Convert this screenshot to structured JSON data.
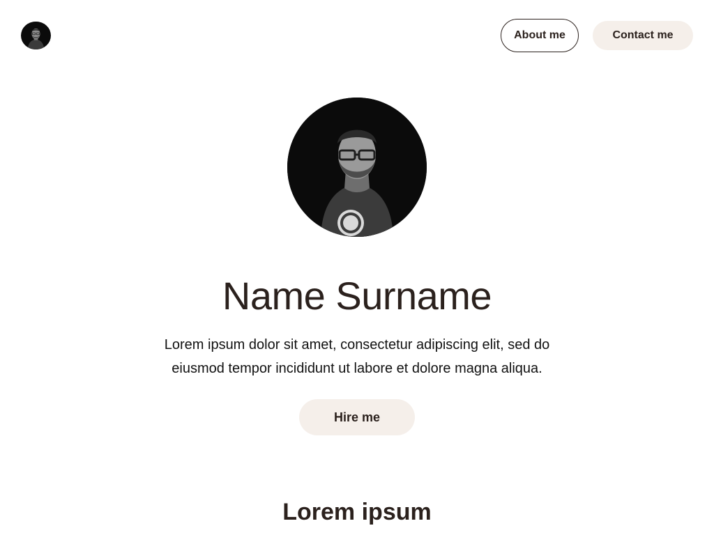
{
  "header": {
    "avatar_icon": "person-avatar-icon",
    "nav": {
      "about_label": "About me",
      "contact_label": "Contact me"
    }
  },
  "hero": {
    "avatar_icon": "person-portrait-icon",
    "title": "Name Surname",
    "description": "Lorem ipsum dolor sit amet, consectetur adipiscing elit, sed do eiusmod tempor incididunt ut labore et dolore magna aliqua.",
    "hire_label": "Hire me"
  },
  "section": {
    "title": "Lorem ipsum"
  },
  "colors": {
    "text": "#2b211d",
    "pill_background": "#f5efea",
    "avatar_background": "#0b0b0b"
  }
}
